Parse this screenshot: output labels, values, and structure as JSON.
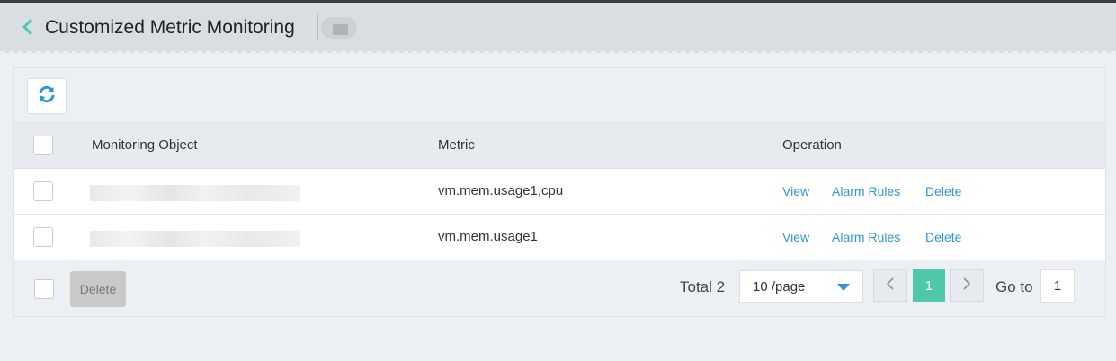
{
  "header": {
    "title": "Customized Metric Monitoring"
  },
  "table": {
    "columns": [
      "Monitoring Object",
      "Metric",
      "Operation"
    ],
    "rows": [
      {
        "metric": "vm.mem.usage1,cpu",
        "actions": [
          "View",
          "Alarm Rules",
          "Delete"
        ]
      },
      {
        "metric": "vm.mem.usage1",
        "actions": [
          "View",
          "Alarm Rules",
          "Delete"
        ]
      }
    ]
  },
  "footer": {
    "delete_label": "Delete",
    "total_label": "Total 2",
    "page_size": "10 /page",
    "current_page": "1",
    "goto_label": "Go to",
    "goto_value": "1"
  },
  "colors": {
    "accent_green": "#4fc8a9",
    "link_blue": "#2f96d6",
    "header_bg": "#d9dee2"
  },
  "icons": [
    "chevron-left-icon",
    "refresh-icon",
    "caret-down-icon",
    "chevron-left-icon",
    "chevron-right-icon"
  ]
}
